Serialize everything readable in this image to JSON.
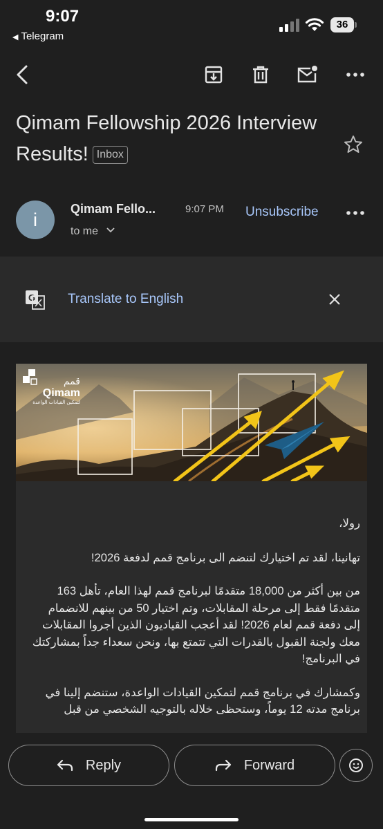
{
  "status": {
    "time": "9:07",
    "back_app": "Telegram",
    "battery": "36"
  },
  "toolbar": {
    "back": "back-arrow-icon",
    "archive": "archive-icon",
    "delete": "trash-icon",
    "unread": "mail-unread-icon",
    "more": "more-dots-icon"
  },
  "email": {
    "subject": "Qimam Fellowship 2026 Interview Results!",
    "label": "Inbox",
    "avatar_letter": "i",
    "sender": "Qimam Fello...",
    "time": "9:07 PM",
    "unsubscribe": "Unsubscribe",
    "to": "to me"
  },
  "translate": {
    "label": "Translate to English"
  },
  "banner": {
    "brand_ar": "قمم",
    "brand_en": "Qimam",
    "tagline_ar": "لتمكين القيادات الواعدة"
  },
  "body": {
    "greeting": "رولا،",
    "p1": "تهانينا، لقد تم اختيارك لتنضم الى برنامج قمم لدفعة 2026!",
    "p2": "من بين أكثر من 18,000 متقدمًا لبرنامج قمم لهذا العام، تأهل 163 متقدمًا فقط إلى مرحلة المقابلات، وتم اختيار 50 من بينهم للانضمام إلى دفعة قمم لعام 2026! لقد أعجب القياديون الذين أجروا المقابلات معك ولجنة القبول بالقدرات التي تتمتع بها، ونحن سعداء جداً بمشاركتك في البرنامج!",
    "p3": "وكمشارك في برنامج قمم لتمكين القيادات الواعدة، ستنضم إلينا في برنامج مدته 12 يوماً، وستحظى خلاله بالتوجيه الشخصي من قبل"
  },
  "actions": {
    "reply": "Reply",
    "forward": "Forward",
    "emoji": "emoji-icon"
  },
  "colors": {
    "background": "#1f1f1f",
    "link": "#a8c7fa",
    "avatar": "#7b96a8"
  }
}
